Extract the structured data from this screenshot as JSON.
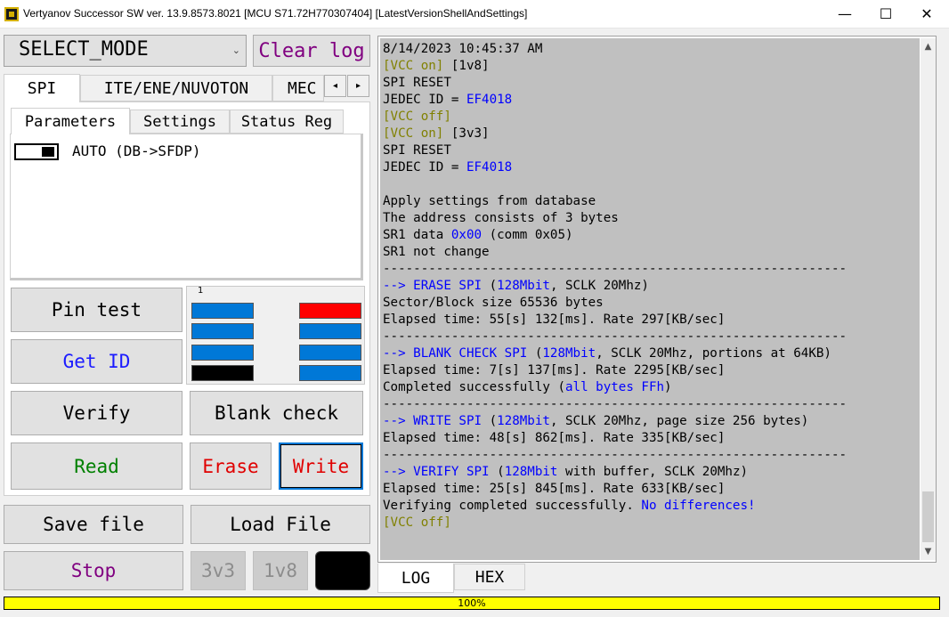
{
  "window": {
    "title": "Vertyanov Successor SW ver. 13.9.8573.8021 [MCU S71.72H770307404] [LatestVersionShellAndSettings]",
    "minimize_glyph": "—",
    "maximize_glyph": "☐",
    "close_glyph": "✕"
  },
  "toolbar": {
    "mode_select_value": "SELECT_MODE",
    "mode_select_arrow": "⌄",
    "clear_log_label": "Clear log"
  },
  "tabs": {
    "items": [
      {
        "label": "SPI",
        "selected": true
      },
      {
        "label": "ITE/ENE/NUVOTON",
        "selected": false
      },
      {
        "label": "MEC",
        "selected": false
      }
    ],
    "scroll_left": "◂",
    "scroll_right": "▸"
  },
  "subtabs": {
    "items": [
      {
        "label": "Parameters",
        "selected": true
      },
      {
        "label": "Settings",
        "selected": false
      },
      {
        "label": "Status Reg",
        "selected": false
      }
    ]
  },
  "parameters": {
    "auto_label": "AUTO (DB->SFDP)",
    "auto_enabled": true
  },
  "actions": {
    "pin_test": "Pin test",
    "get_id": "Get ID",
    "verify": "Verify",
    "blank_check": "Blank check",
    "read": "Read",
    "erase": "Erase",
    "write": "Write",
    "save_file": "Save file",
    "load_file": "Load File",
    "stop": "Stop",
    "v3": "3v3",
    "v1": "1v8"
  },
  "pin_panel": {
    "label": "1",
    "pins": [
      "#0078d7",
      "#ff0000",
      "#0078d7",
      "#0078d7",
      "#0078d7",
      "#0078d7",
      "#000000",
      "#0078d7"
    ]
  },
  "colors": {
    "pin_blue": "#0078d7",
    "pin_red": "#ff0000",
    "pin_black": "#000000",
    "vcc_text": "#808000",
    "log_highlight": "#0000ff",
    "log_background": "#c0c0c0",
    "progress_fill": "#ffff00"
  },
  "log": {
    "lines": [
      [
        {
          "t": "8/14/2023 10:45:37 AM"
        }
      ],
      [
        {
          "t": "[VCC on]",
          "c": "vcc"
        },
        {
          "t": " [1v8]"
        }
      ],
      [
        {
          "t": "SPI RESET"
        }
      ],
      [
        {
          "t": "JEDEC ID = "
        },
        {
          "t": "EF4018",
          "c": "blue"
        }
      ],
      [
        {
          "t": "[VCC off]",
          "c": "vcc"
        }
      ],
      [
        {
          "t": "[VCC on]",
          "c": "vcc"
        },
        {
          "t": " [3v3]"
        }
      ],
      [
        {
          "t": "SPI RESET"
        }
      ],
      [
        {
          "t": "JEDEC ID = "
        },
        {
          "t": "EF4018",
          "c": "blue"
        }
      ],
      [
        {
          "t": ""
        }
      ],
      [
        {
          "t": "Apply settings from database"
        }
      ],
      [
        {
          "t": "The address consists of 3 bytes"
        }
      ],
      [
        {
          "t": "SR1 data "
        },
        {
          "t": "0x00",
          "c": "blue"
        },
        {
          "t": " (comm 0x05)"
        }
      ],
      [
        {
          "t": "SR1 not change"
        }
      ],
      [
        {
          "t": "-------------------------------------------------------------"
        }
      ],
      [
        {
          "t": "--> ERASE SPI",
          "c": "blue"
        },
        {
          "t": " ("
        },
        {
          "t": "128Mbit",
          "c": "blue"
        },
        {
          "t": ", SCLK 20Mhz)"
        }
      ],
      [
        {
          "t": "Sector/Block size 65536 bytes"
        }
      ],
      [
        {
          "t": "Elapsed time: 55[s] 132[ms]. Rate 297[KB/sec]"
        }
      ],
      [
        {
          "t": "-------------------------------------------------------------"
        }
      ],
      [
        {
          "t": "--> BLANK CHECK SPI",
          "c": "blue"
        },
        {
          "t": " ("
        },
        {
          "t": "128Mbit",
          "c": "blue"
        },
        {
          "t": ", SCLK 20Mhz, portions at 64KB)"
        }
      ],
      [
        {
          "t": "Elapsed time: 7[s] 137[ms]. Rate 2295[KB/sec]"
        }
      ],
      [
        {
          "t": "Completed successfully ("
        },
        {
          "t": "all bytes FFh",
          "c": "blue"
        },
        {
          "t": ")"
        }
      ],
      [
        {
          "t": "-------------------------------------------------------------"
        }
      ],
      [
        {
          "t": "--> WRITE SPI",
          "c": "blue"
        },
        {
          "t": " ("
        },
        {
          "t": "128Mbit",
          "c": "blue"
        },
        {
          "t": ", SCLK 20Mhz, page size 256 bytes)"
        }
      ],
      [
        {
          "t": "Elapsed time: 48[s] 862[ms]. Rate 335[KB/sec]"
        }
      ],
      [
        {
          "t": "-------------------------------------------------------------"
        }
      ],
      [
        {
          "t": "--> VERIFY SPI",
          "c": "blue"
        },
        {
          "t": " ("
        },
        {
          "t": "128Mbit",
          "c": "blue"
        },
        {
          "t": " with buffer, SCLK 20Mhz)"
        }
      ],
      [
        {
          "t": "Elapsed time: 25[s] 845[ms]. Rate 633[KB/sec]"
        }
      ],
      [
        {
          "t": "Verifying completed successfully. "
        },
        {
          "t": "No differences!",
          "c": "blue"
        }
      ],
      [
        {
          "t": "[VCC off]",
          "c": "vcc"
        }
      ]
    ],
    "scroll_up": "▲",
    "scroll_down": "▼"
  },
  "bottom_tabs": {
    "log": "LOG",
    "hex": "HEX"
  },
  "progress": {
    "value": 100,
    "label": "100%"
  }
}
